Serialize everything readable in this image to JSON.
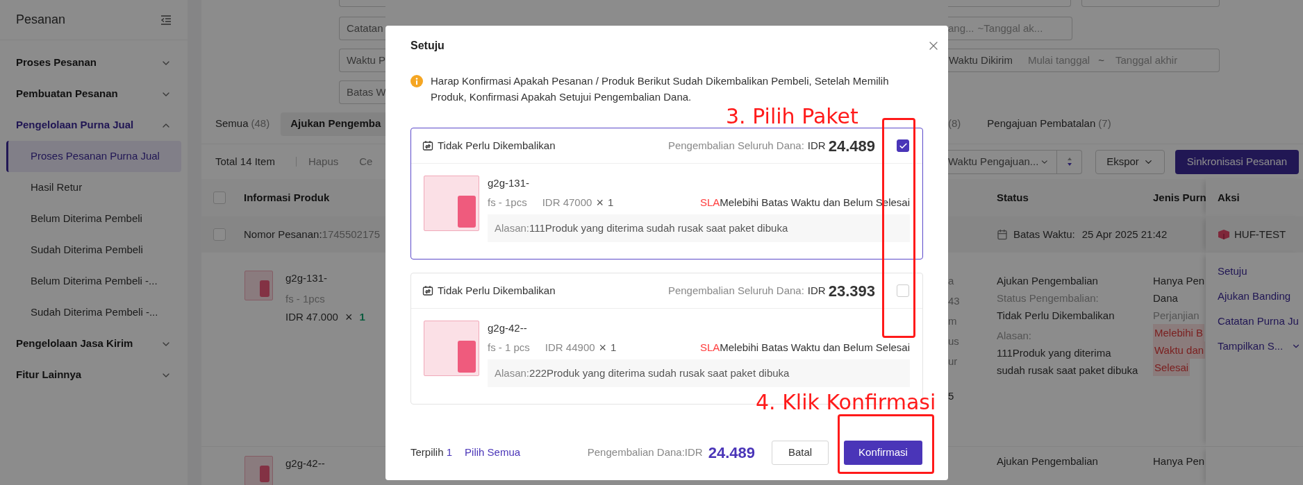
{
  "sidebar": {
    "title": "Pesanan",
    "groups": [
      {
        "label": "Proses Pesanan",
        "expanded": false,
        "active": false
      },
      {
        "label": "Pembuatan Pesanan",
        "expanded": false,
        "active": false
      },
      {
        "label": "Pengelolaan Purna Jual",
        "expanded": true,
        "active": true,
        "children": [
          {
            "label": "Proses Pesanan Purna Jual",
            "selected": true
          },
          {
            "label": "Hasil Retur",
            "selected": false
          },
          {
            "label": "Belum Diterima Pembeli",
            "selected": false
          },
          {
            "label": "Sudah Diterima Pembeli",
            "selected": false
          },
          {
            "label": "Belum Diterima Pembeli -...",
            "selected": false
          },
          {
            "label": "Sudah Diterima Pembeli -...",
            "selected": false
          }
        ]
      },
      {
        "label": "Pengelolaan Jasa Kirim",
        "expanded": false,
        "active": false
      },
      {
        "label": "Fitur Lainnya",
        "expanded": false,
        "active": false
      }
    ]
  },
  "filters": {
    "left": [
      {
        "label": "Catatan"
      },
      {
        "label": "Waktu P"
      },
      {
        "label": "Batas W"
      }
    ],
    "right": [
      {
        "start": "ang...",
        "end": "~Tanggal ak..."
      },
      {
        "label": "Waktu Dikirim",
        "start": "Mulai tanggal",
        "separator": "~",
        "end": "Tanggal akhir"
      }
    ]
  },
  "tabs": {
    "left": [
      {
        "label": "Semua",
        "count": "(48)",
        "selected": false
      },
      {
        "label": "Ajukan Pengemba",
        "selected": true
      }
    ],
    "right": [
      {
        "count": "(8)",
        "selected": false
      },
      {
        "label": "Pengajuan Pembatalan",
        "count": "(7)",
        "selected": false
      }
    ]
  },
  "toolbar": {
    "total": "Total 14 Item",
    "actions": [
      "Hapus",
      "Ce"
    ],
    "sort_select": "Waktu Pengajuan...",
    "export": "Ekspor",
    "sync": "Sinkronisasi Pesanan"
  },
  "table": {
    "select_all_checked": false,
    "columns": {
      "left": "Informasi Produk",
      "right": [
        "Status",
        "Jenis Purn",
        "Aksi"
      ]
    },
    "order": {
      "checked": false,
      "label": "Nomor Pesanan:",
      "number": "1745502175",
      "deadline_label": "Batas Waktu:",
      "deadline": "25 Apr 2025 21:42",
      "store": "HUF-TEST"
    },
    "rows": [
      {
        "product": "g2g-131-",
        "variant": "fs - 1pcs",
        "price": "IDR 47.000",
        "times": "×",
        "qty": "1",
        "column_3": [
          "a",
          "43",
          "m",
          "us",
          "ur",
          "5"
        ],
        "status": "Ajukan Pengembalian",
        "return_status_label": "Status Pengembalian:",
        "return_status": "Tidak Perlu Dikembalikan",
        "reason_label": "Alasan:",
        "reason": "111Produk yang diterima sudah rusak saat paket dibuka",
        "type_lines": [
          "Hanya Pen",
          "Dana"
        ],
        "agreement": "Perjanjian",
        "tag_lines": [
          "Melebihi B",
          "Waktu dan",
          "Selesai"
        ],
        "actions": [
          "Setuju",
          "Ajukan Banding",
          "Catatan Purna Ju",
          "Tampilkan S..."
        ]
      },
      {
        "product": "g2g-42--",
        "status": "Ajukan Pengembalian",
        "type_lines": [
          "Hanya Pen"
        ]
      }
    ]
  },
  "dialog": {
    "title": "Setuju",
    "notice": "Harap Konfirmasi Apakah Pesanan / Produk Berikut Sudah Dikembalikan Pembeli, Setelah Memilih Produk, Konfirmasi Apakah Setujui Pengembalian Dana.",
    "packages": [
      {
        "return_type": "Tidak Perlu Dikembalikan",
        "refund_label": "Pengembalian Seluruh Dana:",
        "currency": "IDR",
        "amount": "24.489",
        "selected": true,
        "product": "g2g-131-",
        "variant": "fs - 1pcs",
        "price": "IDR 47000",
        "times": "×",
        "qty": "1",
        "sla": "SLA",
        "sla_text": "Melebihi Batas Waktu dan Belum Selesai",
        "reason_label": "Alasan:",
        "reason": "111Produk yang diterima sudah rusak saat paket dibuka"
      },
      {
        "return_type": "Tidak Perlu Dikembalikan",
        "refund_label": "Pengembalian Seluruh Dana:",
        "currency": "IDR",
        "amount": "23.393",
        "selected": false,
        "product": "g2g-42--",
        "variant": "fs - 1 pcs",
        "price": "IDR 44900",
        "times": "×",
        "qty": "1",
        "sla": "SLA",
        "sla_text": "Melebihi Batas Waktu dan Belum Selesai",
        "reason_label": "Alasan:",
        "reason": "222Produk yang diterima sudah rusak saat paket dibuka"
      }
    ],
    "footer": {
      "selected_label": "Terpilih",
      "selected_count": "1",
      "select_all": "Pilih Semua",
      "refund_label": "Pengembalian Dana:IDR",
      "refund_amount": "24.489",
      "cancel": "Batal",
      "confirm": "Konfirmasi"
    }
  },
  "annotations": [
    {
      "text": "3. Pilih Paket"
    },
    {
      "text": "4. Klik Konfirmasi"
    }
  ]
}
